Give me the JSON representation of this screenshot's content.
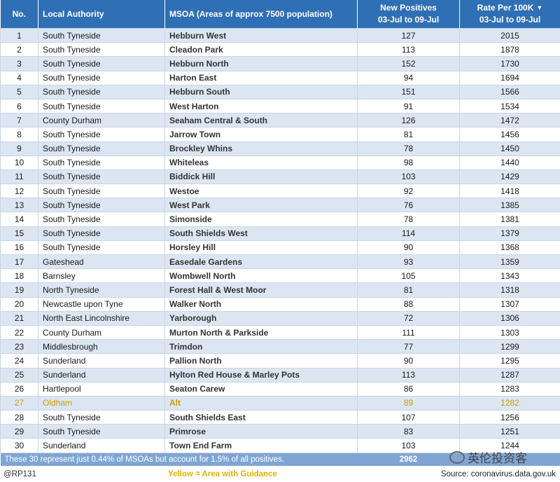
{
  "header": {
    "no": "No.",
    "authority": "Local Authority",
    "msoa": "MSOA (Areas of approx 7500 population)",
    "positives_line1": "New Positives",
    "positives_line2": "03-Jul to 09-Jul",
    "rate_line1": "Rate Per 100K",
    "rate_line2": "03-Jul to 09-Jul"
  },
  "rows": [
    {
      "no": "1",
      "authority": "South Tyneside",
      "msoa": "Hebburn West",
      "positives": "127",
      "rate": "2015"
    },
    {
      "no": "2",
      "authority": "South Tyneside",
      "msoa": "Cleadon Park",
      "positives": "113",
      "rate": "1878"
    },
    {
      "no": "3",
      "authority": "South Tyneside",
      "msoa": "Hebburn North",
      "positives": "152",
      "rate": "1730"
    },
    {
      "no": "4",
      "authority": "South Tyneside",
      "msoa": "Harton East",
      "positives": "94",
      "rate": "1694"
    },
    {
      "no": "5",
      "authority": "South Tyneside",
      "msoa": "Hebburn South",
      "positives": "151",
      "rate": "1566"
    },
    {
      "no": "6",
      "authority": "South Tyneside",
      "msoa": "West Harton",
      "positives": "91",
      "rate": "1534"
    },
    {
      "no": "7",
      "authority": "County Durham",
      "msoa": "Seaham Central & South",
      "positives": "126",
      "rate": "1472"
    },
    {
      "no": "8",
      "authority": "South Tyneside",
      "msoa": "Jarrow Town",
      "positives": "81",
      "rate": "1456"
    },
    {
      "no": "9",
      "authority": "South Tyneside",
      "msoa": "Brockley Whins",
      "positives": "78",
      "rate": "1450"
    },
    {
      "no": "10",
      "authority": "South Tyneside",
      "msoa": "Whiteleas",
      "positives": "98",
      "rate": "1440"
    },
    {
      "no": "11",
      "authority": "South Tyneside",
      "msoa": "Biddick Hill",
      "positives": "103",
      "rate": "1429"
    },
    {
      "no": "12",
      "authority": "South Tyneside",
      "msoa": "Westoe",
      "positives": "92",
      "rate": "1418"
    },
    {
      "no": "13",
      "authority": "South Tyneside",
      "msoa": "West Park",
      "positives": "76",
      "rate": "1385"
    },
    {
      "no": "14",
      "authority": "South Tyneside",
      "msoa": "Simonside",
      "positives": "78",
      "rate": "1381"
    },
    {
      "no": "15",
      "authority": "South Tyneside",
      "msoa": "South Shields West",
      "positives": "114",
      "rate": "1379"
    },
    {
      "no": "16",
      "authority": "South Tyneside",
      "msoa": "Horsley Hill",
      "positives": "90",
      "rate": "1368"
    },
    {
      "no": "17",
      "authority": "Gateshead",
      "msoa": "Easedale Gardens",
      "positives": "93",
      "rate": "1359"
    },
    {
      "no": "18",
      "authority": "Barnsley",
      "msoa": "Wombwell North",
      "positives": "105",
      "rate": "1343"
    },
    {
      "no": "19",
      "authority": "North Tyneside",
      "msoa": "Forest Hall & West Moor",
      "positives": "81",
      "rate": "1318"
    },
    {
      "no": "20",
      "authority": "Newcastle upon Tyne",
      "msoa": "Walker North",
      "positives": "88",
      "rate": "1307"
    },
    {
      "no": "21",
      "authority": "North East Lincolnshire",
      "msoa": "Yarborough",
      "positives": "72",
      "rate": "1306"
    },
    {
      "no": "22",
      "authority": "County Durham",
      "msoa": "Murton North & Parkside",
      "positives": "111",
      "rate": "1303"
    },
    {
      "no": "23",
      "authority": "Middlesbrough",
      "msoa": "Trimdon",
      "positives": "77",
      "rate": "1299"
    },
    {
      "no": "24",
      "authority": "Sunderland",
      "msoa": "Pallion North",
      "positives": "90",
      "rate": "1295"
    },
    {
      "no": "25",
      "authority": "Sunderland",
      "msoa": "Hylton Red House & Marley Pots",
      "positives": "113",
      "rate": "1287"
    },
    {
      "no": "26",
      "authority": "Hartlepool",
      "msoa": "Seaton Carew",
      "positives": "86",
      "rate": "1283"
    },
    {
      "no": "27",
      "authority": "Oldham",
      "msoa": "Alt",
      "positives": "89",
      "rate": "1282",
      "highlight": true
    },
    {
      "no": "28",
      "authority": "South Tyneside",
      "msoa": "South Shields East",
      "positives": "107",
      "rate": "1256"
    },
    {
      "no": "29",
      "authority": "South Tyneside",
      "msoa": "Primrose",
      "positives": "83",
      "rate": "1251"
    },
    {
      "no": "30",
      "authority": "Sunderland",
      "msoa": "Town End Farm",
      "positives": "103",
      "rate": "1244"
    }
  ],
  "summary": {
    "note": "These 30 represent just 0.44% of MSOAs but account for 1.5% of all positives.",
    "total": "2962"
  },
  "footer": {
    "handle": "@RP131",
    "legend": "Yellow = Area with Guidance",
    "source": "Source: coronavirus.data.gov.uk"
  },
  "watermark": "英伦投资客",
  "colors": {
    "header": "#2f6fb5",
    "stripe": "#dce6f3",
    "summary": "#7fa6d3",
    "highlight": "#c9a000"
  }
}
